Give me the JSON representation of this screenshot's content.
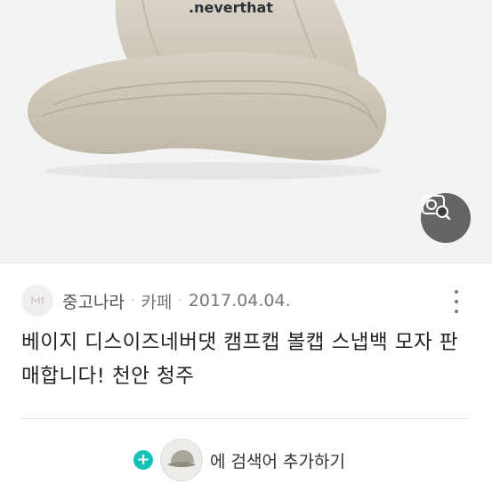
{
  "product_image": {
    "alt": ""
  },
  "lens_button": {
    "icon": "image-search-icon"
  },
  "post_meta": {
    "avatar_icon": "cafe-avatar-icon",
    "source": "중고나라",
    "separator": "·",
    "category": "카페",
    "date": "2017.04.04."
  },
  "more_menu": {
    "icon": "more-vertical-icon"
  },
  "title": "베이지 디스이즈네버댓 캠프캡 볼캡 스냅백 모자 판매합니다! 천안 청주",
  "keyword": {
    "plus_icon": "+",
    "text": "에 검색어 추가하기"
  },
  "colors": {
    "accent": "#14c3b8",
    "text": "#222222",
    "meta": "#777777"
  }
}
